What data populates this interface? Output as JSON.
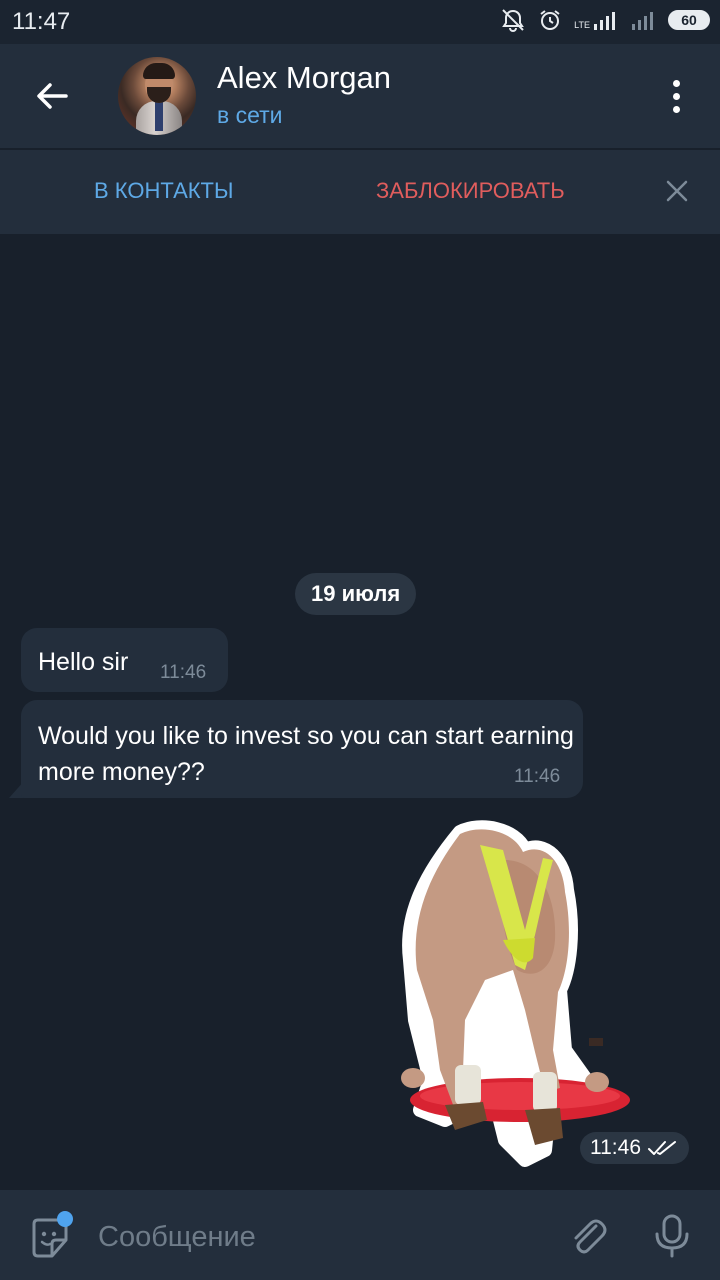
{
  "statusbar": {
    "time": "11:47",
    "lte": "LTE",
    "battery": "60",
    "icons": [
      "mute-icon",
      "alarm-icon",
      "signal-icon",
      "signal-2-icon",
      "battery-icon"
    ]
  },
  "header": {
    "contact_name": "Alex Morgan",
    "contact_status": "в сети"
  },
  "actionbar": {
    "add_contact": "В КОНТАКТЫ",
    "block": "ЗАБЛОКИРОВАТЬ"
  },
  "chat": {
    "date": "19 июля",
    "messages": [
      {
        "text": "Hello sir",
        "time": "11:46"
      },
      {
        "text": "Would you like to invest so you can start earning more money??",
        "time": "11:46"
      }
    ],
    "sticker": {
      "time": "11:46",
      "read_state": "double-check-icon"
    }
  },
  "composer": {
    "placeholder": "Сообщение"
  },
  "colors": {
    "background": "#18202b",
    "header": "#232e3c",
    "accent": "#5ea9e6",
    "danger": "#e05d5d",
    "bubble": "#232e3c"
  }
}
